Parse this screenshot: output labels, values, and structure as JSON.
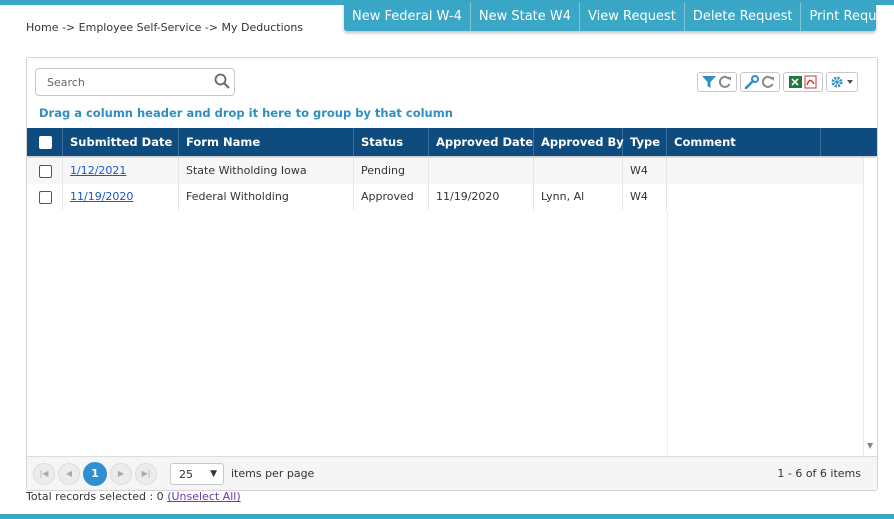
{
  "breadcrumb": "Home -> Employee Self-Service -> My Deductions",
  "actions": {
    "new_federal": "New Federal W-4",
    "new_state": "New State W4",
    "view": "View Request",
    "delete": "Delete Request",
    "print": "Print Request"
  },
  "search": {
    "placeholder": "Search"
  },
  "group_hint": "Drag a column header and drop it here to group by that column",
  "columns": {
    "submitted_date": "Submitted Date",
    "form_name": "Form Name",
    "status": "Status",
    "approved_date": "Approved Date",
    "approved_by": "Approved By",
    "type": "Type",
    "comment": "Comment"
  },
  "rows": [
    {
      "submitted_date": "1/12/2021",
      "form_name": "State Witholding Iowa",
      "status": "Pending",
      "approved_date": "",
      "approved_by": "",
      "type": "W4",
      "comment": ""
    },
    {
      "submitted_date": "11/19/2020",
      "form_name": "Federal Witholding",
      "status": "Approved",
      "approved_date": "11/19/2020",
      "approved_by": "Lynn, Al",
      "type": "W4",
      "comment": ""
    }
  ],
  "pager": {
    "current_page": "1",
    "page_size": "25",
    "items_per_page_label": "items per page",
    "info": "1 - 6 of 6 items"
  },
  "footer": {
    "selected_label": "Total records selected : 0",
    "unselect_link": "(Unselect All)"
  },
  "colors": {
    "accent": "#3aa7c7",
    "header_bg": "#0e4b7e",
    "link": "#1a57c9",
    "page_current": "#2f8fd0",
    "group_hint": "#2f8fc0"
  },
  "icons": [
    "search-icon",
    "filter-icon",
    "refresh-icon",
    "wrench-icon",
    "excel-icon",
    "pdf-icon",
    "gear-icon"
  ]
}
